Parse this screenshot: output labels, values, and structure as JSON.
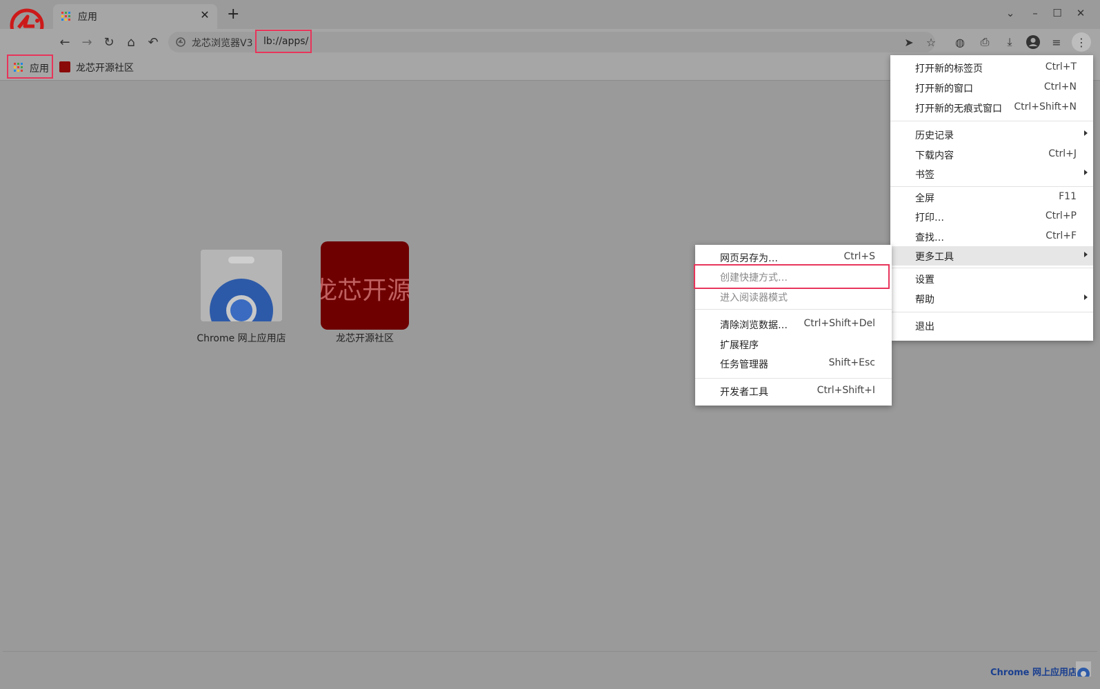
{
  "tab": {
    "title": "应用"
  },
  "omnibox": {
    "site_label": "龙芯浏览器V3",
    "url": "lb://apps/"
  },
  "bookmarks": {
    "apps_label": "应用",
    "community_label": "龙芯开源社区"
  },
  "apps": [
    {
      "label": "Chrome 网上应用店"
    },
    {
      "label": "龙芯开源社区",
      "tile_text": "龙芯开源"
    }
  ],
  "status": {
    "store_link": "Chrome 网上应用店"
  },
  "main_menu": {
    "items": [
      {
        "label": "打开新的标签页",
        "shortcut": "Ctrl+T"
      },
      {
        "label": "打开新的窗口",
        "shortcut": "Ctrl+N"
      },
      {
        "label": "打开新的无痕式窗口",
        "shortcut": "Ctrl+Shift+N"
      },
      {
        "label": "历史记录",
        "shortcut": ""
      },
      {
        "label": "下载内容",
        "shortcut": "Ctrl+J"
      },
      {
        "label": "书签",
        "shortcut": ""
      },
      {
        "label": "全屏",
        "shortcut": "F11"
      },
      {
        "label": "打印…",
        "shortcut": "Ctrl+P"
      },
      {
        "label": "查找…",
        "shortcut": "Ctrl+F"
      },
      {
        "label": "更多工具",
        "shortcut": ""
      },
      {
        "label": "设置",
        "shortcut": ""
      },
      {
        "label": "帮助",
        "shortcut": ""
      },
      {
        "label": "退出",
        "shortcut": ""
      }
    ]
  },
  "more_tools_menu": {
    "items": [
      {
        "label": "网页另存为…",
        "shortcut": "Ctrl+S"
      },
      {
        "label": "创建快捷方式…",
        "shortcut": ""
      },
      {
        "label": "进入阅读器模式",
        "shortcut": ""
      },
      {
        "label": "清除浏览数据…",
        "shortcut": "Ctrl+Shift+Del"
      },
      {
        "label": "扩展程序",
        "shortcut": ""
      },
      {
        "label": "任务管理器",
        "shortcut": "Shift+Esc"
      },
      {
        "label": "开发者工具",
        "shortcut": "Ctrl+Shift+I"
      }
    ]
  },
  "colors": {
    "highlight_border": "#e8345a",
    "community_red": "#6e0000",
    "link_blue": "#1a3f8f"
  }
}
